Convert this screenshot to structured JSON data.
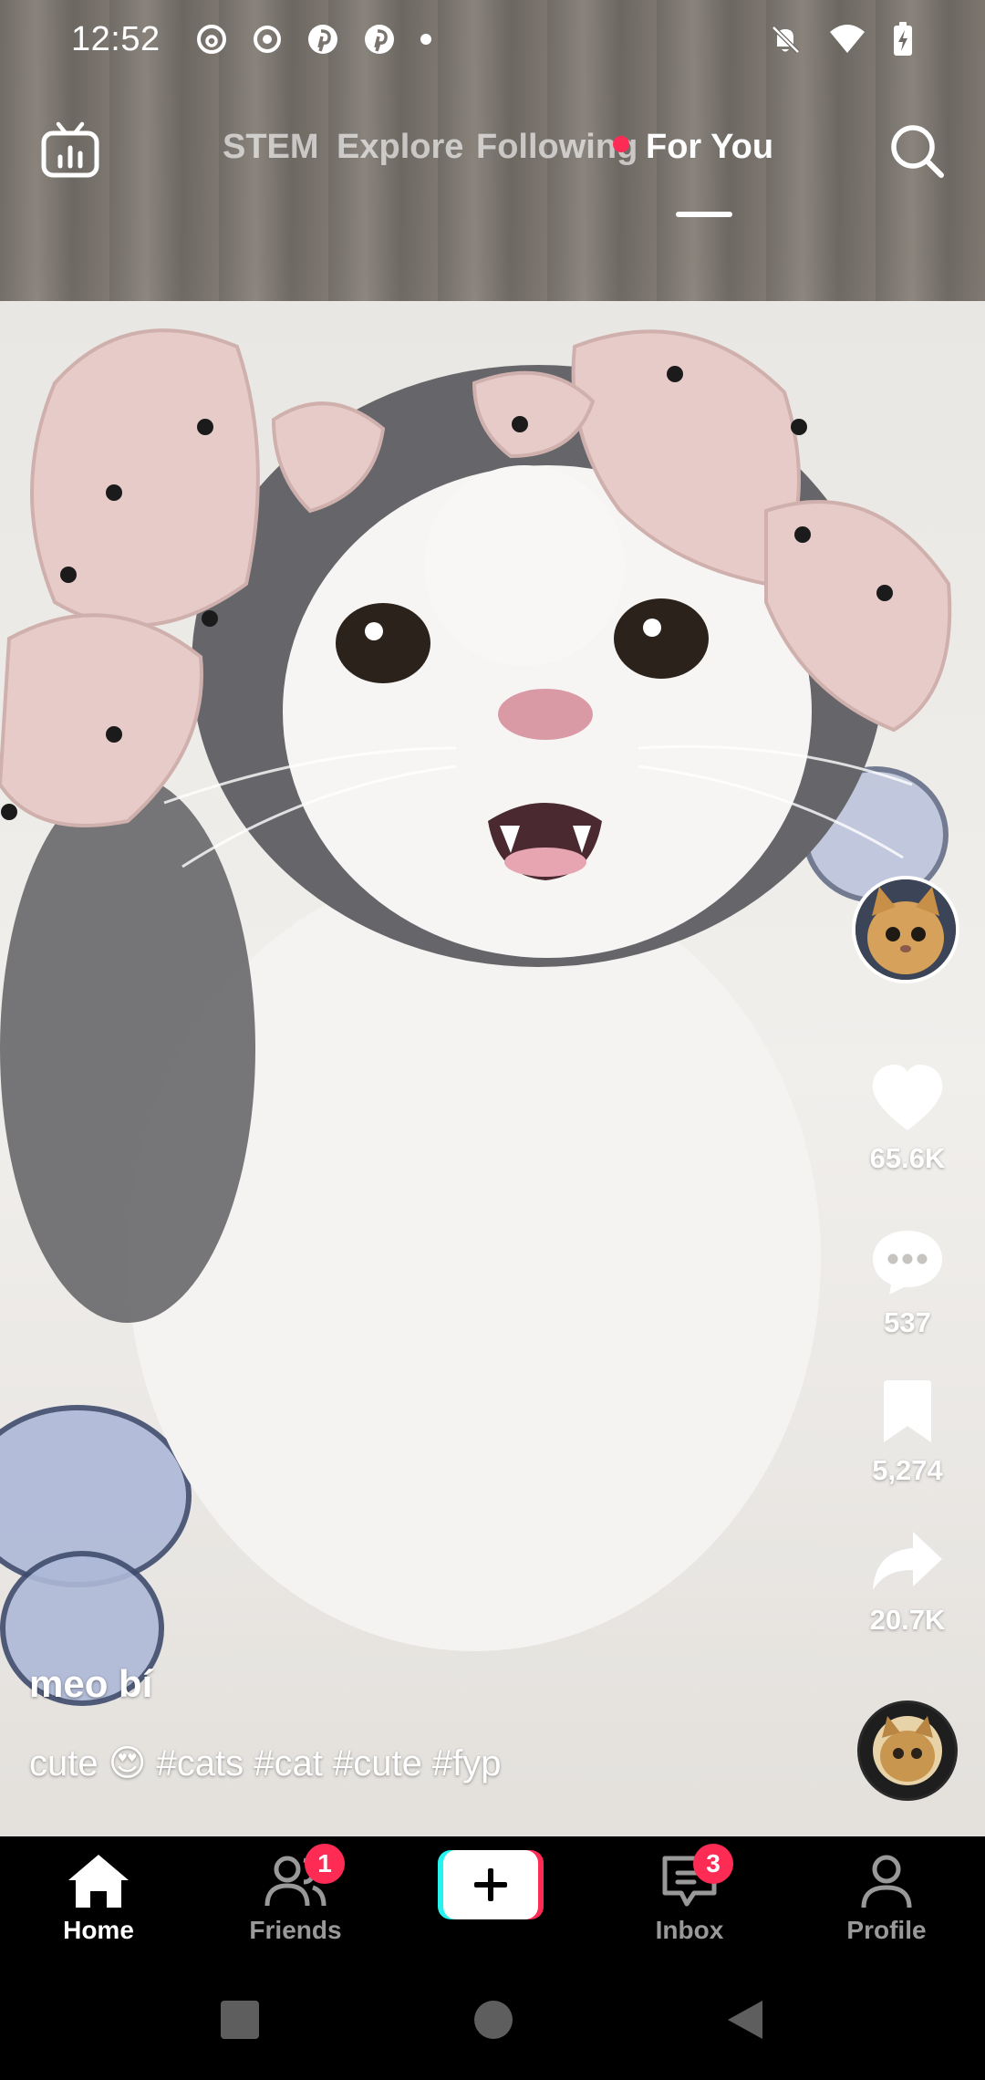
{
  "status_bar": {
    "time": "12:52",
    "left_icons": [
      "threads-icon",
      "record-icon",
      "pinterest-icon",
      "pinterest-icon",
      "dot-icon"
    ],
    "right_icons": [
      "bell-muted-icon",
      "wifi-icon",
      "battery-charging-icon"
    ]
  },
  "top_nav": {
    "tabs": [
      {
        "label": "STEM",
        "active": false
      },
      {
        "label": "Explore",
        "active": false
      },
      {
        "label": "Following",
        "active": false,
        "has_dot": true
      },
      {
        "label": "For You",
        "active": true
      }
    ],
    "left_icon": "live-tv-icon",
    "right_icon": "search-icon"
  },
  "actions": {
    "likes": "65.6K",
    "comments": "537",
    "saves": "5,274",
    "shares": "20.7K"
  },
  "caption": {
    "author": "meo bí",
    "text": "cute 😍 #cats #cat #cute #fyp"
  },
  "bottom_nav": {
    "home": "Home",
    "friends": "Friends",
    "friends_badge": "1",
    "inbox": "Inbox",
    "inbox_badge": "3",
    "profile": "Profile"
  },
  "colors": {
    "accent": "#fe2c55",
    "cyan": "#25f4ee",
    "background": "#000000"
  }
}
